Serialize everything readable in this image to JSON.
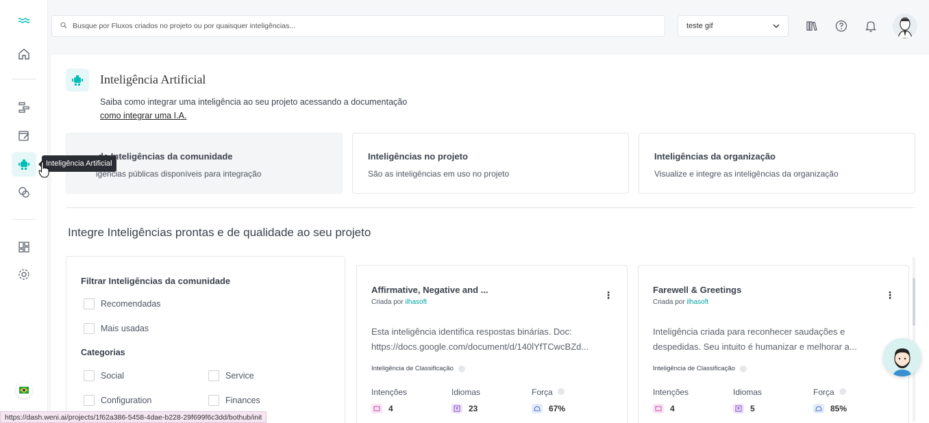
{
  "colors": {
    "accent": "#00bdb8",
    "accent_bg": "#e5f8f7",
    "author": "#00a3a3",
    "tooltip_bg": "#2a2d33"
  },
  "sidebar": {
    "items": [
      {
        "name": "logo-icon"
      },
      {
        "name": "home-icon"
      },
      {
        "name": "flows-icon"
      },
      {
        "name": "studio-icon"
      },
      {
        "name": "robot-icon",
        "active": true
      },
      {
        "name": "chats-icon"
      },
      {
        "name": "apps-icon"
      },
      {
        "name": "settings-icon"
      }
    ],
    "tooltip": "Inteligência Artificial",
    "language_flag": "brazil-flag-icon"
  },
  "topbar": {
    "search_placeholder": "Busque por Fluxos criados no projeto ou por quaisquer inteligências...",
    "project": "teste gif",
    "icons": [
      "library-icon",
      "help-icon",
      "bell-icon",
      "avatar"
    ]
  },
  "header": {
    "title": "Inteligência Artificial",
    "description": "Saiba como integrar uma inteligência ao seu projeto acessando a documentação",
    "link": "como integrar uma I.A."
  },
  "tabs": [
    {
      "title": "Central de Inteligências da comunidade",
      "visible_title": "de Inteligências da comunidade",
      "subtitle": "Inteligências públicas disponíveis para integração",
      "visible_subtitle": "igências públicas disponíveis para integração",
      "active": true
    },
    {
      "title": "Inteligências no projeto",
      "subtitle": "São as inteligências em uso no projeto"
    },
    {
      "title": "Inteligências da organização",
      "subtitle": "Visualize e integre as inteligências da organização"
    }
  ],
  "section_title": "Integre Inteligências prontas e de qualidade ao seu projeto",
  "filter": {
    "title": "Filtrar Inteligências da comunidade",
    "options": [
      "Recomendadas",
      "Mais usadas"
    ],
    "categories_title": "Categorias",
    "categories": [
      "Social",
      "Service",
      "Configuration",
      "Finances"
    ]
  },
  "cards": [
    {
      "name": "Affirmative, Negative and ...",
      "created_by_label": "Criada por",
      "author": "ilhasoft",
      "description_line1": "Esta inteligência identifica respostas binárias. Doc:",
      "description_line2": "https://docs.google.com/document/d/140lYfTCwcBZd...",
      "type": "Inteligência de Classificação",
      "metrics": {
        "intents_label": "Intenções",
        "intents": "4",
        "languages_label": "Idiomas",
        "languages": "23",
        "strength_label": "Força",
        "strength": "67%"
      }
    },
    {
      "name": "Farewell & Greetings",
      "created_by_label": "Criada por",
      "author": "ilhasoft",
      "description_line1": "Inteligência criada para reconhecer saudações e",
      "description_line2": "despedidas. Seu intuito é humanizar e melhorar a...",
      "type": "Inteligência de Classificação",
      "metrics": {
        "intents_label": "Intenções",
        "intents": "4",
        "languages_label": "Idiomas",
        "languages": "5",
        "strength_label": "Força",
        "strength": "85%"
      }
    }
  ],
  "status_url": "https://dash.weni.ai/projects/1f62a386-5458-4dae-b228-29f699f6c3dd/bothub/init"
}
